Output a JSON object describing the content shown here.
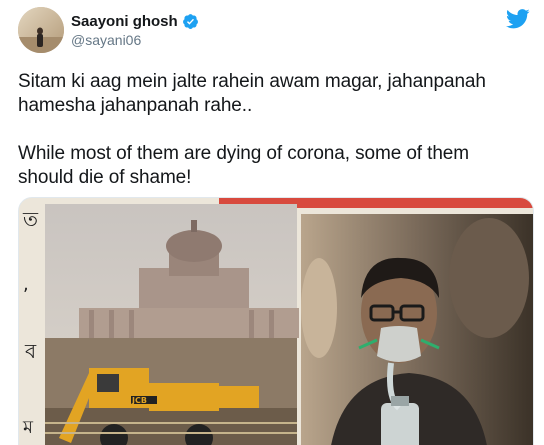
{
  "tweet": {
    "author": {
      "display_name": "Saayoni ghosh",
      "handle": "@sayani06",
      "verified": true,
      "avatar_icon": "avatar-photo"
    },
    "brand_icon": "twitter-bird-icon",
    "brand_color": "#1da1f2",
    "paragraphs": [
      "Sitam ki aag mein jalte rahein awam magar, jahanpanah\nhamesha jahanpanah rahe..",
      "While most of them are dying of corona, some of them\nshould die of shame!"
    ],
    "media": {
      "type": "photo",
      "description_icon": "newspaper-photo",
      "header_text": "JCB"
    }
  },
  "colors": {
    "text_primary": "#14171a",
    "text_secondary": "#657786",
    "verified_blue": "#1da1f2"
  }
}
